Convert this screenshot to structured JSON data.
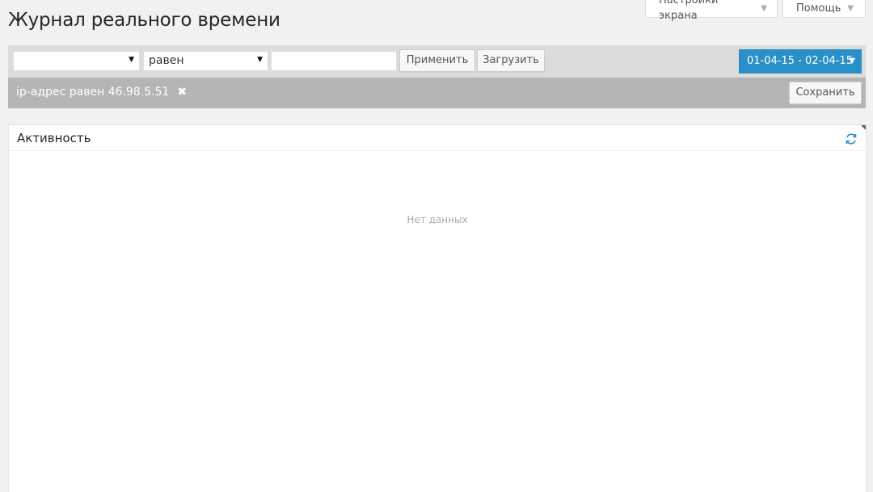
{
  "page": {
    "title": "Журнал реального времени"
  },
  "header_tabs": {
    "screen_options": "Настройки экрана",
    "help": "Помощь"
  },
  "filter_bar": {
    "field_select_value": "",
    "operator_select_value": "равен",
    "value_input": "",
    "apply_label": "Применить",
    "load_label": "Загрузить",
    "date_range": "01-04-15 - 02-04-15"
  },
  "active_filter": {
    "label": "ip-адрес равен 46.98.5.51",
    "save_label": "Сохранить"
  },
  "activity_panel": {
    "title": "Активность",
    "empty_text": "Нет данных"
  },
  "colors": {
    "accent": "#2a8fc7",
    "filter_bar": "#dcdcdc",
    "active_filter_bar": "#b5b5b5"
  }
}
